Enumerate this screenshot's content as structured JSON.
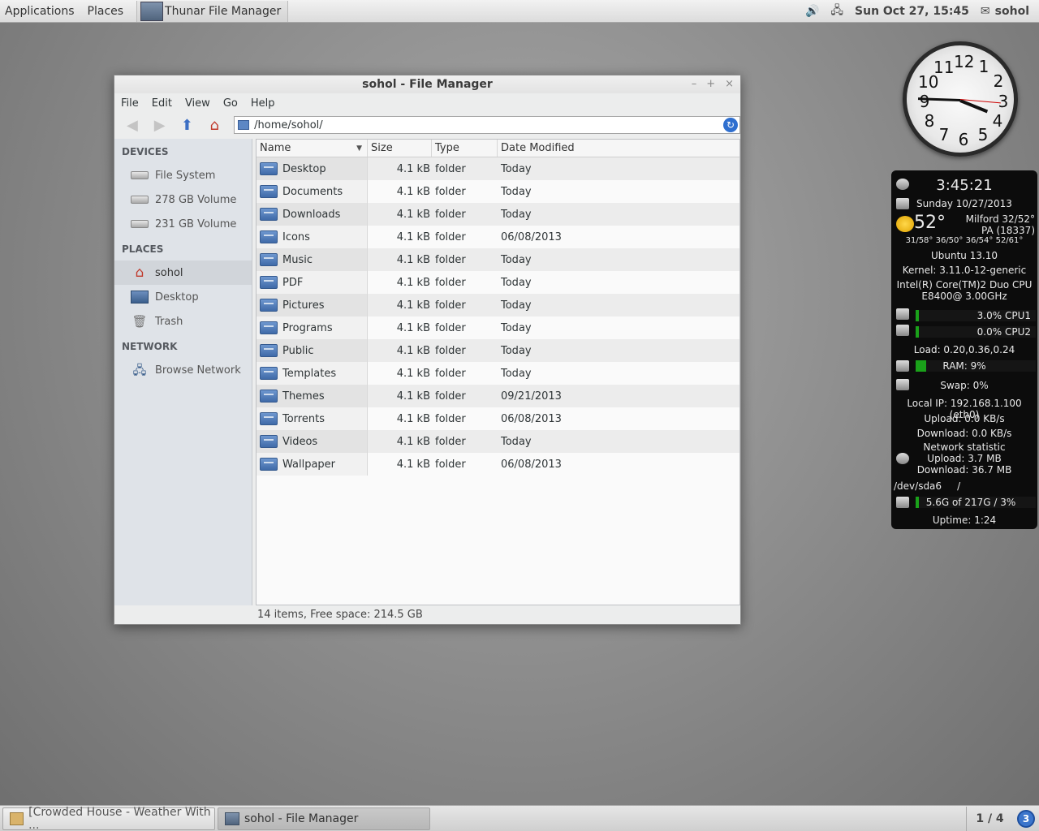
{
  "top_panel": {
    "applications": "Applications",
    "places": "Places",
    "task": "Thunar File Manager",
    "volume_icon": "🔊",
    "network_icon": "🖧",
    "datetime": "Sun Oct 27, 15:45",
    "user_icon": "✉",
    "user": "sohol"
  },
  "window": {
    "title": "sohol - File Manager",
    "controls": {
      "minimize": "–",
      "maximize": "+",
      "close": "×"
    },
    "menu": [
      "File",
      "Edit",
      "View",
      "Go",
      "Help"
    ],
    "toolbar": {
      "back": "◀",
      "forward": "▶",
      "up": "⬆",
      "home": "⌂"
    },
    "location": "/home/sohol/",
    "reload": "↻",
    "sidebar": {
      "devices_title": "DEVICES",
      "devices": [
        "File System",
        "278 GB Volume",
        "231 GB Volume"
      ],
      "places_title": "PLACES",
      "places": [
        "sohol",
        "Desktop",
        "Trash"
      ],
      "network_title": "NETWORK",
      "network": [
        "Browse Network"
      ]
    },
    "columns": {
      "name": "Name",
      "size": "Size",
      "type": "Type",
      "date": "Date Modified"
    },
    "sort_icon": "▼",
    "files": [
      {
        "name": "Desktop",
        "size": "4.1 kB",
        "type": "folder",
        "date": "Today"
      },
      {
        "name": "Documents",
        "size": "4.1 kB",
        "type": "folder",
        "date": "Today"
      },
      {
        "name": "Downloads",
        "size": "4.1 kB",
        "type": "folder",
        "date": "Today"
      },
      {
        "name": "Icons",
        "size": "4.1 kB",
        "type": "folder",
        "date": "06/08/2013"
      },
      {
        "name": "Music",
        "size": "4.1 kB",
        "type": "folder",
        "date": "Today"
      },
      {
        "name": "PDF",
        "size": "4.1 kB",
        "type": "folder",
        "date": "Today"
      },
      {
        "name": "Pictures",
        "size": "4.1 kB",
        "type": "folder",
        "date": "Today"
      },
      {
        "name": "Programs",
        "size": "4.1 kB",
        "type": "folder",
        "date": "Today"
      },
      {
        "name": "Public",
        "size": "4.1 kB",
        "type": "folder",
        "date": "Today"
      },
      {
        "name": "Templates",
        "size": "4.1 kB",
        "type": "folder",
        "date": "Today"
      },
      {
        "name": "Themes",
        "size": "4.1 kB",
        "type": "folder",
        "date": "09/21/2013"
      },
      {
        "name": "Torrents",
        "size": "4.1 kB",
        "type": "folder",
        "date": "06/08/2013"
      },
      {
        "name": "Videos",
        "size": "4.1 kB",
        "type": "folder",
        "date": "Today"
      },
      {
        "name": "Wallpaper",
        "size": "4.1 kB",
        "type": "folder",
        "date": "06/08/2013"
      }
    ],
    "status": "14 items, Free space: 214.5 GB"
  },
  "clock": {
    "numbers": [
      "12",
      "1",
      "2",
      "3",
      "4",
      "5",
      "6",
      "7",
      "8",
      "9",
      "10",
      "11"
    ]
  },
  "conky": {
    "time": "3:45:21",
    "date": "Sunday 10/27/2013",
    "temp": "52°",
    "location1": "Milford 32/52°",
    "location2": "PA (18337)",
    "forecast": "31/58° 36/50° 36/54° 52/61°",
    "os": "Ubuntu 13.10",
    "kernel": "Kernel: 3.11.0-12-generic",
    "cpu_model1": "Intel(R) Core(TM)2 Duo CPU",
    "cpu_model2": "E8400@ 3.00GHz",
    "cpu1": "3.0% CPU1",
    "cpu1_fraction": 0.03,
    "cpu2": "0.0% CPU2",
    "cpu2_fraction": 0.0,
    "load": "Load: 0.20,0.36,0.24",
    "ram": "RAM: 9%",
    "ram_fraction": 0.09,
    "swap": "Swap: 0%",
    "ip": "Local IP: 192.168.1.100 (eth0)",
    "upload": "Upload: 0.0 KB/s",
    "download": "Download: 0.0 KB/s",
    "net_title": "Network statistic",
    "net_upload": "Upload: 3.7 MB",
    "net_download": "Download: 36.7 MB",
    "disk": "/dev/sda6     /",
    "disk_usage": "5.6G of 217G / 3%",
    "disk_fraction": 0.03,
    "uptime": "Uptime: 1:24"
  },
  "bottom_panel": {
    "task1": "[Crowded House - Weather With ...",
    "task2": "sohol - File Manager",
    "workspace": "1 / 4",
    "notifications": "3"
  }
}
